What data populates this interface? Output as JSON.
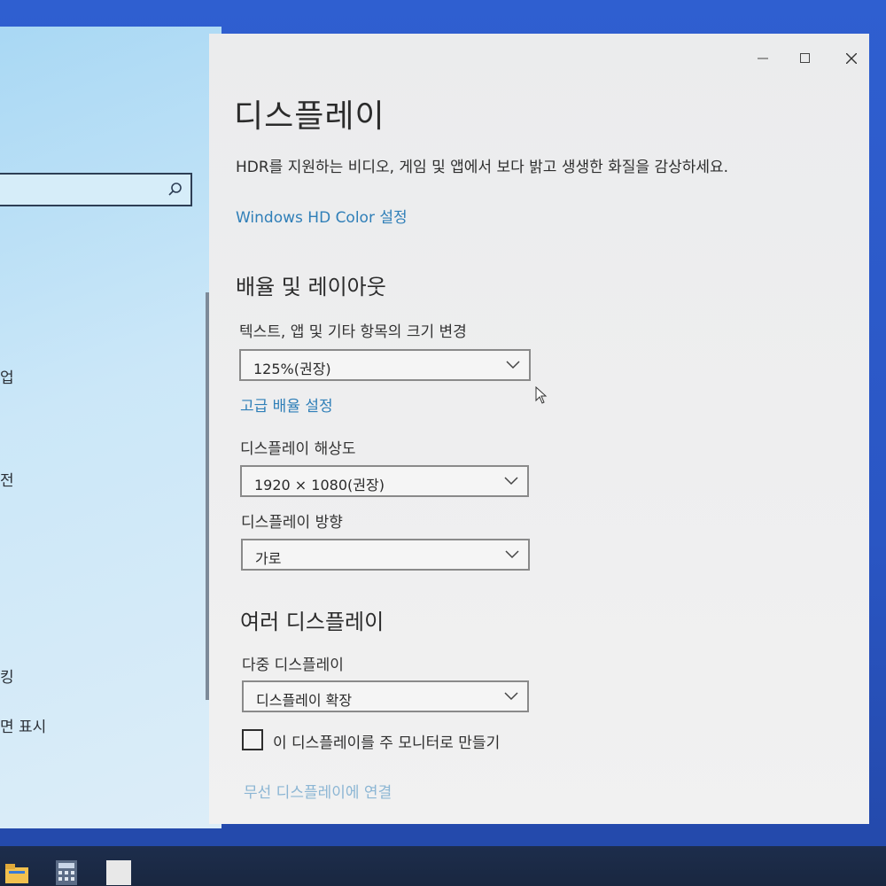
{
  "left_nav": {
    "search_placeholder": "",
    "items": [
      "업",
      "전",
      "킹",
      "면 표시"
    ]
  },
  "window": {
    "controls": {
      "minimize": "—",
      "maximize": "☐",
      "close": "✕"
    },
    "title": "디스플레이",
    "hdr_description": "HDR를 지원하는 비디오, 게임 및 앱에서 보다 밝고 생생한 화질을 감상하세요.",
    "hdr_link": "Windows HD Color 설정",
    "scale_section": {
      "title": "배율 및 레이아웃",
      "text_size_label": "텍스트, 앱 및 기타 항목의 크기 변경",
      "text_size_value": "125%(권장)",
      "advanced_scaling_link": "고급 배율 설정",
      "resolution_label": "디스플레이 해상도",
      "resolution_value": "1920 × 1080(권장)",
      "orientation_label": "디스플레이 방향",
      "orientation_value": "가로"
    },
    "multi_section": {
      "title": "여러 디스플레이",
      "multi_label": "다중 디스플레이",
      "multi_value": "디스플레이 확장",
      "main_display_checkbox": "이 디스플레이를 주 모니터로 만들기",
      "main_display_checked": false,
      "wireless_link": "무선 디스플레이에 연결"
    }
  },
  "colors": {
    "link": "#2f7fb8",
    "desktop": "#2f5fd0",
    "taskbar": "#1d2d4c"
  }
}
